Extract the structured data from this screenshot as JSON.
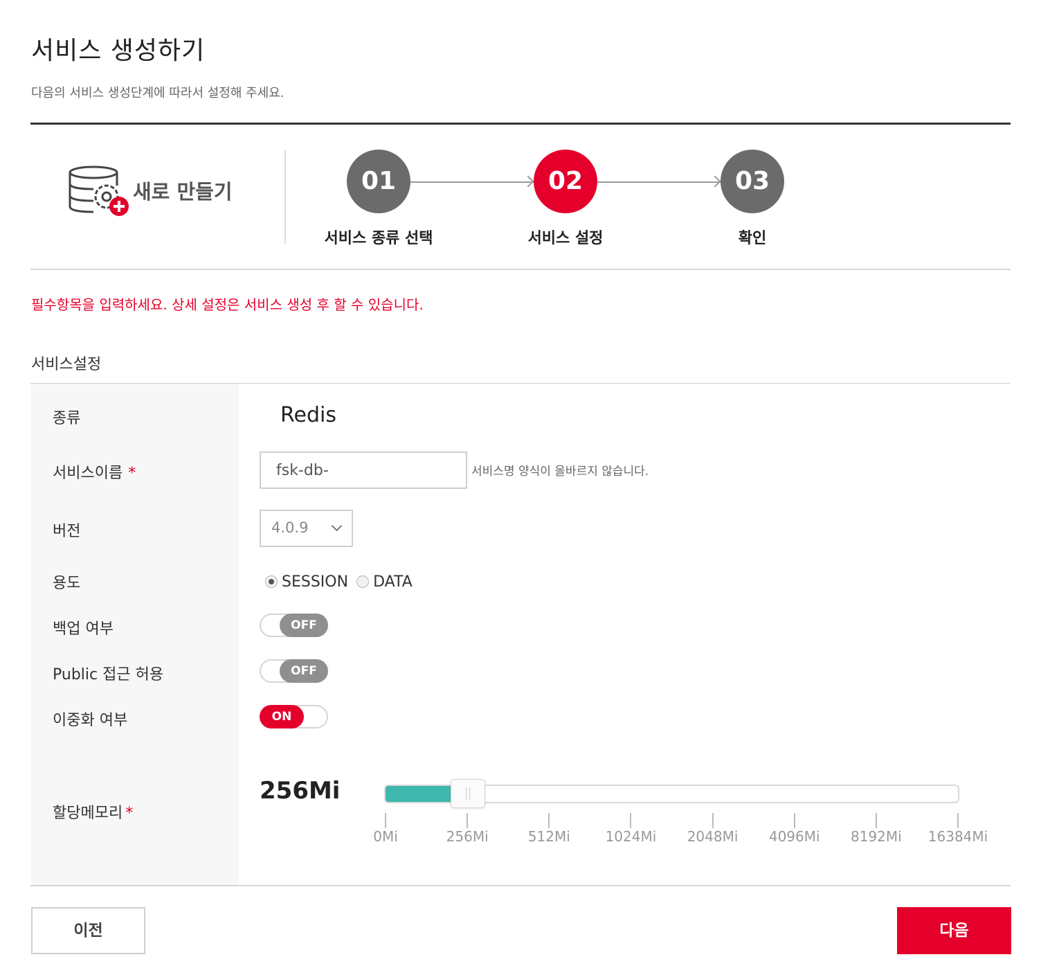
{
  "header": {
    "title": "서비스 생성하기",
    "subtitle": "다음의 서비스 생성단계에 따라서 설정해 주세요."
  },
  "create_block": {
    "label": "새로 만들기",
    "icon": "database-gear-add-icon"
  },
  "steps": [
    {
      "number": "01",
      "label": "서비스 종류 선택",
      "state": "done"
    },
    {
      "number": "02",
      "label": "서비스 설정",
      "state": "current"
    },
    {
      "number": "03",
      "label": "확인",
      "state": "pending"
    }
  ],
  "notice": "필수항목을 입력하세요. 상세 설정은 서비스 생성 후 할 수 있습니다.",
  "section_title": "서비스설정",
  "form": {
    "type_label": "종류",
    "type_value": "Redis",
    "name_label": "서비스이름",
    "name_required": "*",
    "name_value": "fsk-db-",
    "name_error": "서비스명 양식이 올바르지 않습니다.",
    "version_label": "버전",
    "version_value": "4.0.9",
    "usage_label": "용도",
    "usage_options": [
      "SESSION",
      "DATA"
    ],
    "usage_selected": "SESSION",
    "backup_label": "백업 여부",
    "backup_state": "OFF",
    "public_label": "Public 접근 허용",
    "public_state": "OFF",
    "ha_label": "이중화 여부",
    "ha_state": "ON",
    "memory_label": "할당메모리",
    "memory_required": "*",
    "memory_value": "256Mi",
    "memory_ticks": [
      "0Mi",
      "256Mi",
      "512Mi",
      "1024Mi",
      "2048Mi",
      "4096Mi",
      "8192Mi",
      "16384Mi"
    ],
    "memory_selected_index": 1
  },
  "buttons": {
    "prev": "이전",
    "next": "다음"
  },
  "colors": {
    "accent": "#e4002b",
    "step_inactive": "#6b6b6b",
    "slider_fill": "#3fb8ae",
    "toggle_off": "#8f8f8f"
  }
}
